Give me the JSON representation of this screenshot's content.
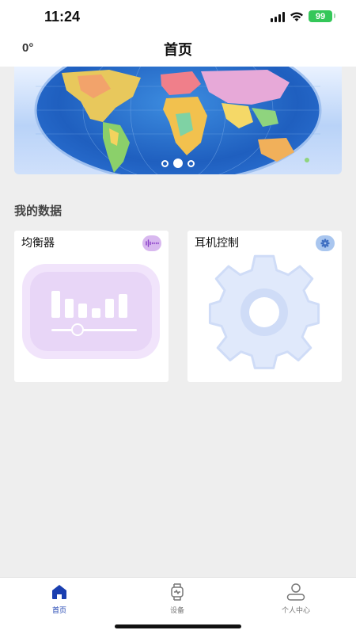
{
  "status_bar": {
    "time": "11:24",
    "battery": "99",
    "icons": [
      "signal-icon",
      "wifi-icon",
      "battery-icon"
    ]
  },
  "header": {
    "temperature": "0°",
    "title": "首页"
  },
  "banner": {
    "image": "world-map",
    "slide_count": 3,
    "active_slide": 2
  },
  "section": {
    "title": "我的数据"
  },
  "cards": [
    {
      "title": "均衡器",
      "icon": "waveform-icon",
      "art": "equalizer-icon",
      "accent": "#c995ec"
    },
    {
      "title": "耳机控制",
      "icon": "gear-icon",
      "art": "gear-icon",
      "accent": "#7ea6e6"
    }
  ],
  "tabbar": {
    "items": [
      {
        "label": "首页",
        "icon": "home-icon",
        "active": true
      },
      {
        "label": "设备",
        "icon": "watch-icon",
        "active": false
      },
      {
        "label": "个人中心",
        "icon": "person-icon",
        "active": false
      }
    ],
    "active_color": "#1a3fb0"
  }
}
